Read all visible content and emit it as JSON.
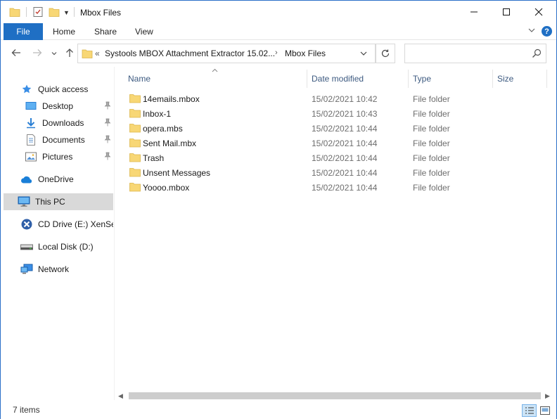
{
  "window": {
    "title": "Mbox Files"
  },
  "ribbon": {
    "file_tab": "File",
    "tabs": [
      "Home",
      "Share",
      "View"
    ]
  },
  "address": {
    "overflow": "«",
    "crumbs": [
      "Systools MBOX Attachment Extractor 15.02...",
      "Mbox Files"
    ],
    "separator": "›"
  },
  "search": {
    "placeholder": ""
  },
  "sidebar": {
    "items": [
      {
        "label": "Quick access",
        "icon": "star-icon"
      },
      {
        "label": "Desktop",
        "icon": "desktop-icon",
        "pinned": true
      },
      {
        "label": "Downloads",
        "icon": "download-icon",
        "pinned": true
      },
      {
        "label": "Documents",
        "icon": "documents-icon",
        "pinned": true
      },
      {
        "label": "Pictures",
        "icon": "pictures-icon",
        "pinned": true
      },
      {
        "label": "OneDrive",
        "icon": "cloud-icon"
      },
      {
        "label": "This PC",
        "icon": "computer-icon",
        "selected": true
      },
      {
        "label": "CD Drive (E:) XenServ",
        "icon": "cd-drive-icon"
      },
      {
        "label": "Local Disk (D:)",
        "icon": "disk-icon"
      },
      {
        "label": "Network",
        "icon": "network-icon"
      }
    ]
  },
  "columns": {
    "name": "Name",
    "date": "Date modified",
    "type": "Type",
    "size": "Size"
  },
  "files": [
    {
      "name": "14emails.mbox",
      "date": "15/02/2021 10:42",
      "type": "File folder"
    },
    {
      "name": "Inbox-1",
      "date": "15/02/2021 10:43",
      "type": "File folder"
    },
    {
      "name": "opera.mbs",
      "date": "15/02/2021 10:44",
      "type": "File folder"
    },
    {
      "name": "Sent Mail.mbx",
      "date": "15/02/2021 10:44",
      "type": "File folder"
    },
    {
      "name": "Trash",
      "date": "15/02/2021 10:44",
      "type": "File folder"
    },
    {
      "name": "Unsent Messages",
      "date": "15/02/2021 10:44",
      "type": "File folder"
    },
    {
      "name": "Yoooo.mbox",
      "date": "15/02/2021 10:44",
      "type": "File folder"
    }
  ],
  "status": {
    "count": "7 items"
  },
  "colors": {
    "accent": "#1f6fc4",
    "folder": "#f8d775",
    "selected_bg": "#d9d9d9",
    "header_text": "#3d5a80"
  }
}
